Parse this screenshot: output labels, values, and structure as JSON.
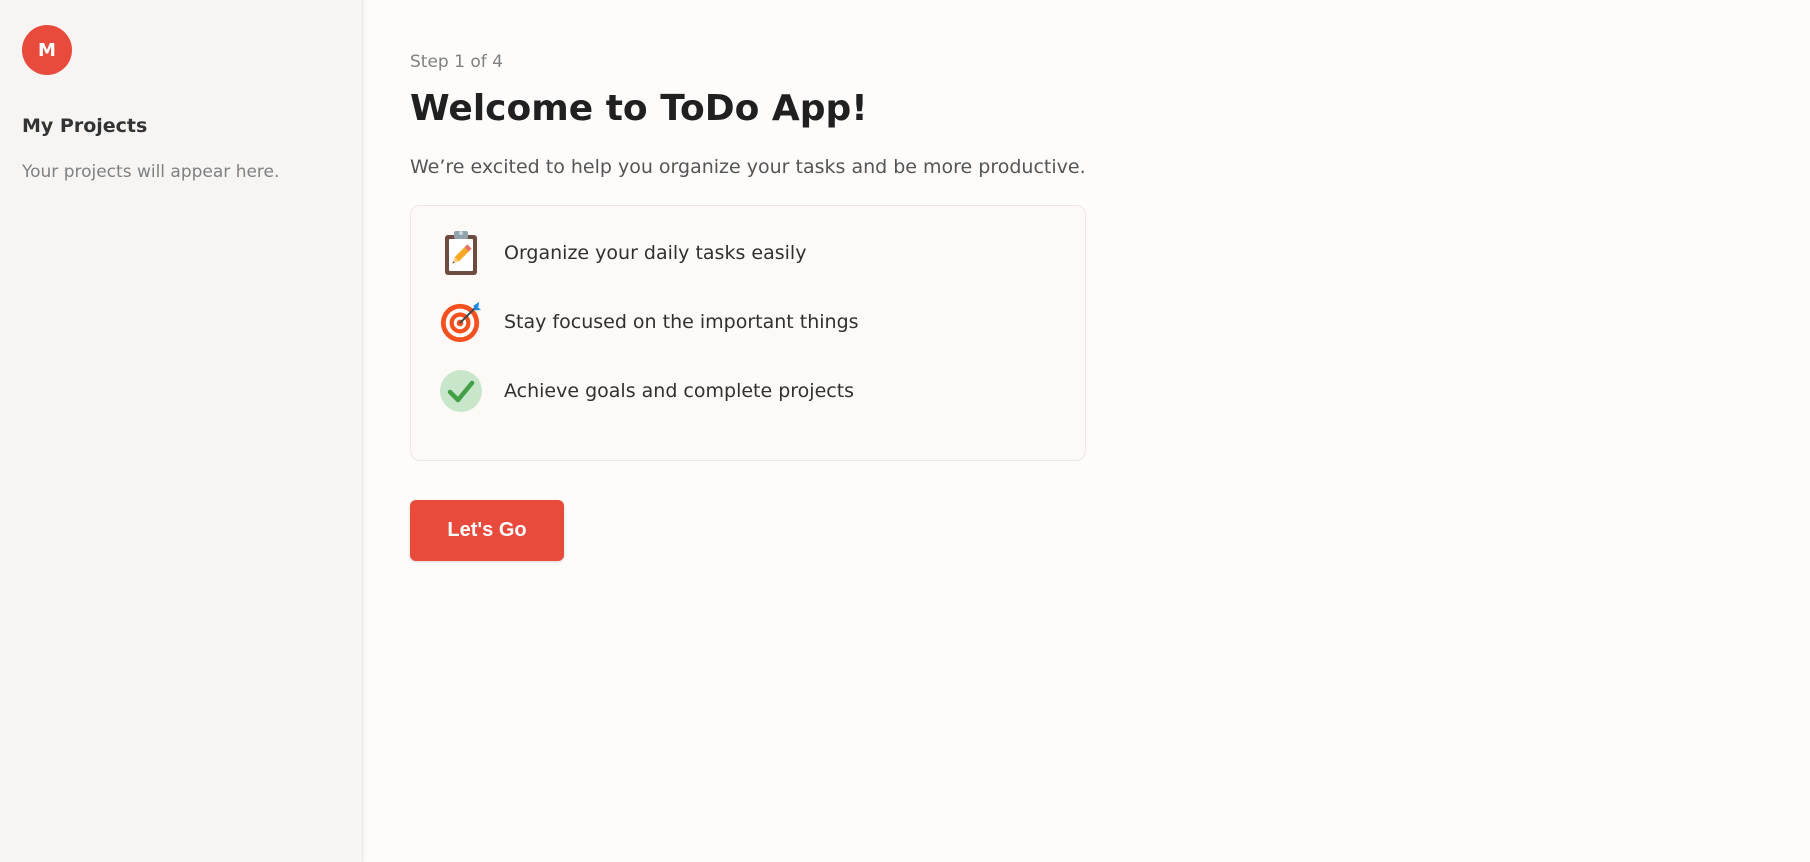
{
  "user": {
    "avatar_initial": "M"
  },
  "sidebar": {
    "title": "My Projects",
    "empty_text": "Your projects will appear here."
  },
  "onboarding": {
    "step_label": "Step 1 of 4",
    "title": "Welcome to ToDo App!",
    "subtitle": "We’re excited to help you organize your tasks and be more productive.",
    "features": [
      {
        "icon": "clipboard-icon",
        "text": "Organize your daily tasks easily"
      },
      {
        "icon": "target-icon",
        "text": "Stay focused on the important things"
      },
      {
        "icon": "checkmark-icon",
        "text": "Achieve goals and complete projects"
      }
    ],
    "button_label": "Let's Go"
  },
  "colors": {
    "accent": "#e84a3c",
    "sidebar_bg": "#f6f5f4",
    "card_bg": "#fdf9f7"
  }
}
